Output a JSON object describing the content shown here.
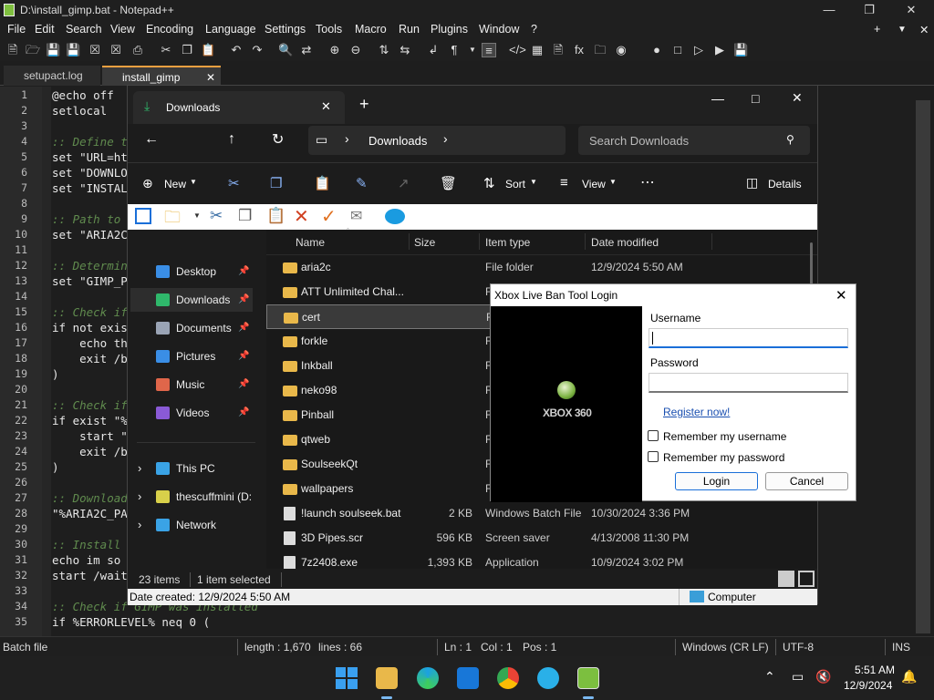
{
  "npp": {
    "title": "D:\\install_gimp.bat - Notepad++",
    "menu": [
      "File",
      "Edit",
      "Search",
      "View",
      "Encoding",
      "Language",
      "Settings",
      "Tools",
      "Macro",
      "Run",
      "Plugins",
      "Window",
      "?"
    ],
    "tabs": [
      "setupact.log",
      "install_gimp"
    ],
    "lines": [
      {
        "n": "1",
        "t": "@echo off",
        "c": false
      },
      {
        "n": "2",
        "t": "setlocal",
        "c": false
      },
      {
        "n": "3",
        "t": "",
        "c": false
      },
      {
        "n": "4",
        "t": ":: Define t",
        "c": true
      },
      {
        "n": "5",
        "t": "set \"URL=ht",
        "c": false
      },
      {
        "n": "6",
        "t": "set \"DOWNLO",
        "c": false
      },
      {
        "n": "7",
        "t": "set \"INSTAL",
        "c": false
      },
      {
        "n": "8",
        "t": "",
        "c": false
      },
      {
        "n": "9",
        "t": ":: Path to",
        "c": true
      },
      {
        "n": "10",
        "t": "set \"ARIA2C",
        "c": false
      },
      {
        "n": "11",
        "t": "",
        "c": false
      },
      {
        "n": "12",
        "t": ":: Determin",
        "c": true
      },
      {
        "n": "13",
        "t": "set \"GIMP_P",
        "c": false
      },
      {
        "n": "14",
        "t": "",
        "c": false
      },
      {
        "n": "15",
        "t": ":: Check if",
        "c": true
      },
      {
        "n": "16",
        "t": "if not exis",
        "c": false
      },
      {
        "n": "17",
        "t": "    echo th",
        "c": false
      },
      {
        "n": "18",
        "t": "    exit /b",
        "c": false
      },
      {
        "n": "19",
        "t": ")",
        "c": false
      },
      {
        "n": "20",
        "t": "",
        "c": false
      },
      {
        "n": "21",
        "t": ":: Check if",
        "c": true
      },
      {
        "n": "22",
        "t": "if exist \"%",
        "c": false
      },
      {
        "n": "23",
        "t": "    start \"",
        "c": false
      },
      {
        "n": "24",
        "t": "    exit /b",
        "c": false
      },
      {
        "n": "25",
        "t": ")",
        "c": false
      },
      {
        "n": "26",
        "t": "",
        "c": false
      },
      {
        "n": "27",
        "t": ":: Download",
        "c": true
      },
      {
        "n": "28",
        "t": "\"%ARIA2C_PA",
        "c": false
      },
      {
        "n": "29",
        "t": "",
        "c": false
      },
      {
        "n": "30",
        "t": ":: Install",
        "c": true
      },
      {
        "n": "31",
        "t": "echo im so",
        "c": false
      },
      {
        "n": "32",
        "t": "start /wait",
        "c": false
      },
      {
        "n": "33",
        "t": "",
        "c": false
      },
      {
        "n": "34",
        "t": ":: Check if GIMP was installed",
        "c": true
      },
      {
        "n": "35",
        "t": "if %ERRORLEVEL% neq 0 (",
        "c": false
      }
    ],
    "status": {
      "type": "Batch file",
      "length": "length : 1,670",
      "lines": "lines : 66",
      "ln": "Ln : 1",
      "col": "Col : 1",
      "pos": "Pos : 1",
      "eol": "Windows (CR LF)",
      "enc": "UTF-8",
      "ins": "INS"
    }
  },
  "explorer": {
    "tab_title": "Downloads",
    "breadcrumb": "Downloads",
    "search_placeholder": "Search Downloads",
    "cmd": {
      "new": "New",
      "sort": "Sort",
      "view": "View",
      "details": "Details"
    },
    "columns": {
      "name": "Name",
      "size": "Size",
      "type": "Item type",
      "date": "Date modified"
    },
    "sidebar": [
      {
        "label": "Desktop",
        "icon": "desktop-icon",
        "color": "#3a8ee6",
        "pinned": true
      },
      {
        "label": "Downloads",
        "icon": "download-icon",
        "color": "#2fb86b",
        "pinned": true
      },
      {
        "label": "Documents",
        "icon": "documents-icon",
        "color": "#9aa4b5",
        "pinned": true
      },
      {
        "label": "Pictures",
        "icon": "pictures-icon",
        "color": "#3a8ee6",
        "pinned": true
      },
      {
        "label": "Music",
        "icon": "music-icon",
        "color": "#e0664a",
        "pinned": true
      },
      {
        "label": "Videos",
        "icon": "videos-icon",
        "color": "#8a5ad6",
        "pinned": true
      }
    ],
    "tree": [
      {
        "label": "This PC",
        "icon": "pc-icon",
        "color": "#3aa3e6"
      },
      {
        "label": "thescuffmini (D:",
        "icon": "drive-icon",
        "color": "#d8d04a"
      },
      {
        "label": "Network",
        "icon": "network-icon",
        "color": "#3aa3e6"
      }
    ],
    "files": [
      {
        "name": "aria2c",
        "size": "",
        "type": "File folder",
        "date": "12/9/2024 5:50 AM",
        "kind": "folder"
      },
      {
        "name": "ATT Unlimited Chal...",
        "size": "",
        "type": "F",
        "date": "",
        "kind": "folder"
      },
      {
        "name": "cert",
        "size": "",
        "type": "F",
        "date": "",
        "kind": "folder"
      },
      {
        "name": "forkle",
        "size": "",
        "type": "F",
        "date": "",
        "kind": "folder"
      },
      {
        "name": "Inkball",
        "size": "",
        "type": "F",
        "date": "",
        "kind": "folder"
      },
      {
        "name": "neko98",
        "size": "",
        "type": "F",
        "date": "",
        "kind": "folder"
      },
      {
        "name": "Pinball",
        "size": "",
        "type": "F",
        "date": "",
        "kind": "folder"
      },
      {
        "name": "qtweb",
        "size": "",
        "type": "F",
        "date": "",
        "kind": "folder"
      },
      {
        "name": "SoulseekQt",
        "size": "",
        "type": "F",
        "date": "",
        "kind": "folder"
      },
      {
        "name": "wallpapers",
        "size": "",
        "type": "F",
        "date": "",
        "kind": "folder"
      },
      {
        "name": "!launch soulseek.bat",
        "size": "2 KB",
        "type": "Windows Batch File",
        "date": "10/30/2024 3:36 PM",
        "kind": "file"
      },
      {
        "name": "3D Pipes.scr",
        "size": "596 KB",
        "type": "Screen saver",
        "date": "4/13/2008 11:30 PM",
        "kind": "file"
      },
      {
        "name": "7z2408.exe",
        "size": "1,393 KB",
        "type": "Application",
        "date": "10/9/2024 3:02 PM",
        "kind": "file"
      }
    ],
    "footer": {
      "items": "23 items",
      "selected": "1 item selected"
    },
    "status": {
      "created": "Date created: 12/9/2024 5:50 AM",
      "computer": "Computer"
    }
  },
  "dialog": {
    "title": "Xbox Live Ban Tool Login",
    "logo": "XBOX 360",
    "username_label": "Username",
    "password_label": "Password",
    "register": "Register now!",
    "remember_user": "Remember my username",
    "remember_pass": "Remember my password",
    "login": "Login",
    "cancel": "Cancel"
  },
  "taskbar": {
    "time": "5:51 AM",
    "date": "12/9/2024"
  }
}
